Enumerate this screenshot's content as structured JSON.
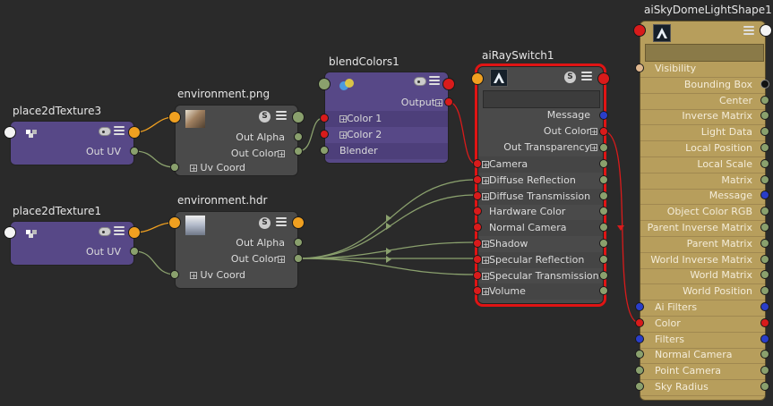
{
  "nodes": {
    "place2dTexture3": {
      "title": "place2dTexture3",
      "out_uv": "Out UV"
    },
    "place2dTexture1": {
      "title": "place2dTexture1",
      "out_uv": "Out UV"
    },
    "envPng": {
      "title": "environment.png",
      "out_alpha": "Out Alpha",
      "out_color": "Out Color",
      "uv_coord": "Uv Coord",
      "s": "S"
    },
    "envHdr": {
      "title": "environment.hdr",
      "out_alpha": "Out Alpha",
      "out_color": "Out Color",
      "uv_coord": "Uv Coord",
      "s": "S"
    },
    "blendColors": {
      "title": "blendColors1",
      "output": "Output",
      "color1": "Color 1",
      "color2": "Color 2",
      "blender": "Blender"
    },
    "rayswitch": {
      "title": "aiRaySwitch1",
      "s": "S",
      "message": "Message",
      "out_color": "Out Color",
      "out_transparency": "Out Transparency",
      "inputs": [
        "Camera",
        "Diffuse Reflection",
        "Diffuse Transmission",
        "Hardware Color",
        "Normal Camera",
        "Shadow",
        "Specular Reflection",
        "Specular Transmission",
        "Volume"
      ]
    },
    "skydome": {
      "title": "aiSkyDomeLightShape1",
      "outputs": [
        "Visibility",
        "Bounding Box",
        "Center",
        "Inverse Matrix",
        "Light Data",
        "Local Position",
        "Local Scale",
        "Matrix",
        "Message",
        "Object Color RGB",
        "Parent Inverse Matrix",
        "Parent Matrix",
        "World Inverse Matrix",
        "World Matrix",
        "World Position"
      ],
      "inputs": [
        "Ai Filters",
        "Color",
        "Filters",
        "Normal Camera",
        "Point Camera",
        "Sky Radius"
      ]
    }
  },
  "colors": {
    "selection": "#e01414",
    "shader_node": "#574887",
    "texture_node": "#4a4a4a",
    "light_node": "#b79e5c",
    "connection_green": "#8aa06d",
    "connection_red": "#d81b1b",
    "connection_orange": "#f0a020"
  }
}
